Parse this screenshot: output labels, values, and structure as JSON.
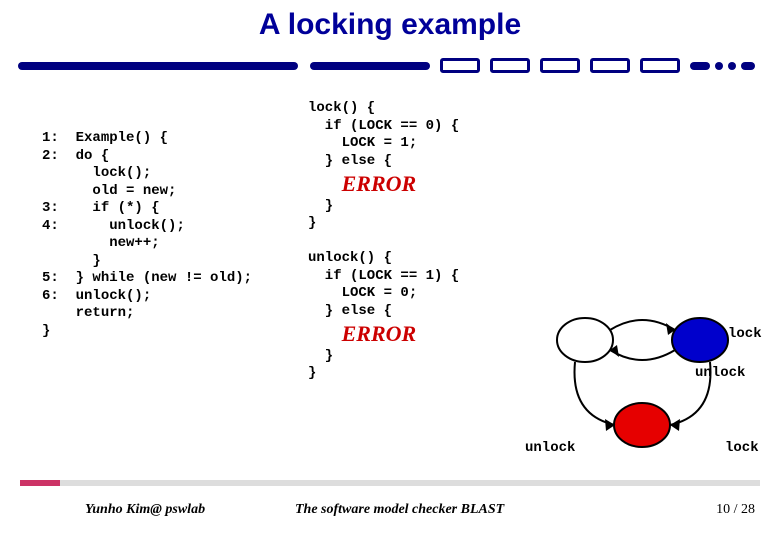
{
  "title": "A locking example",
  "code_left": {
    "l1n": "1:",
    "l1t": "Example() {",
    "l2n": "2:",
    "l2t": "do {",
    "l3t": "  lock();",
    "l4t": "  old = new;",
    "l5n": "3:",
    "l5t": "  if (*) {",
    "l6n": "4:",
    "l6t": "    unlock();",
    "l7t": "    new++;",
    "l8t": "  }",
    "l9n": "5:",
    "l9t": "} while (new != old);",
    "l10n": "6:",
    "l10t": "unlock();",
    "l11t": "return;",
    "l12": "}"
  },
  "code_right": {
    "lock1": "lock() {",
    "lock2": "  if (LOCK == 0) {",
    "lock3": "    LOCK = 1;",
    "lock4": "  } else {",
    "lock5": "  }",
    "lock6": "}",
    "unlock1": "unlock() {",
    "unlock2": "  if (LOCK == 1) {",
    "unlock3": "    LOCK = 0;",
    "unlock4": "  } else {",
    "unlock5": "  }",
    "unlock6": "}"
  },
  "error_label": "ERROR",
  "labels": {
    "lock_r": "lock",
    "unlock_mid": "unlock",
    "unlock_bl": "unlock",
    "lock_br": "lock"
  },
  "footer": {
    "author": "Yunho Kim@ pswlab",
    "subject": "The software model checker BLAST",
    "page_cur": "10",
    "page_sep": " / ",
    "page_total": "28"
  }
}
